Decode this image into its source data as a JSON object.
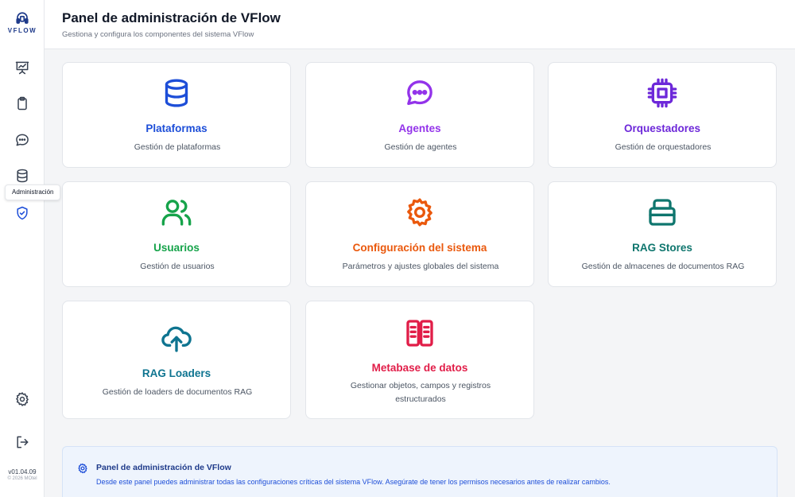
{
  "sidebar": {
    "logo_text": "VFLOW",
    "tooltip": "Administración",
    "version": "v01.04.09",
    "copyright": "© 2026 MOtel",
    "items": [
      {
        "icon": "presentation-chart-icon"
      },
      {
        "icon": "clipboard-icon"
      },
      {
        "icon": "chat-bubble-icon"
      },
      {
        "icon": "database-icon"
      },
      {
        "icon": "shield-check-icon"
      },
      {
        "icon": "gear-icon"
      },
      {
        "icon": "logout-icon"
      }
    ]
  },
  "header": {
    "title": "Panel de administración de VFlow",
    "subtitle": "Gestiona y configura los componentes del sistema VFlow"
  },
  "cards": [
    {
      "title": "Plataformas",
      "description": "Gestión de plataformas",
      "icon": "database-icon",
      "color": "#1d4ed8"
    },
    {
      "title": "Agentes",
      "description": "Gestión de agentes",
      "icon": "chat-bubble-icon",
      "color": "#9333ea"
    },
    {
      "title": "Orquestadores",
      "description": "Gestión de orquestadores",
      "icon": "cpu-chip-icon",
      "color": "#6d28d9"
    },
    {
      "title": "Usuarios",
      "description": "Gestión de usuarios",
      "icon": "users-icon",
      "color": "#16a34a"
    },
    {
      "title": "Configuración del sistema",
      "description": "Parámetros y ajustes globales del sistema",
      "icon": "gear-icon",
      "color": "#ea580c"
    },
    {
      "title": "RAG Stores",
      "description": "Gestión de almacenes de documentos RAG",
      "icon": "archive-stack-icon",
      "color": "#0f766e"
    },
    {
      "title": "RAG Loaders",
      "description": "Gestión de loaders de documentos RAG",
      "icon": "cloud-upload-icon",
      "color": "#0e7490"
    },
    {
      "title": "Metabase de datos",
      "description": "Gestionar objetos, campos y registros estructurados",
      "icon": "book-columns-icon",
      "color": "#e11d48"
    }
  ],
  "info": {
    "title": "Panel de administración de VFlow",
    "text": "Desde este panel puedes administrar todas las configuraciones críticas del sistema VFlow. Asegúrate de tener los permisos necesarios antes de realizar cambios."
  }
}
